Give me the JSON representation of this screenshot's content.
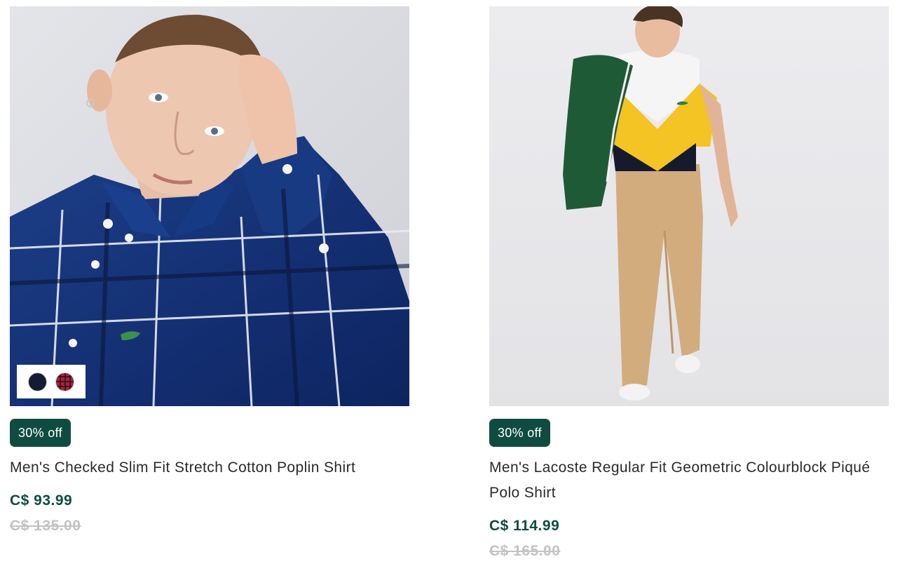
{
  "products": [
    {
      "image_alt": "Model wearing a blue checked button-down shirt",
      "swatches": [
        {
          "name": "Navy",
          "color": "#141c33"
        },
        {
          "name": "Red check",
          "color": "#b3202c"
        }
      ],
      "discount_badge": "30% off",
      "title": "Men's Checked Slim Fit Stretch Cotton Poplin Shirt",
      "price": "C$ 93.99",
      "original_price": "C$ 135.00"
    },
    {
      "image_alt": "Model wearing a yellow, white and black colourblock polo with beige trousers",
      "discount_badge": "30% off",
      "title": "Men's Lacoste Regular Fit Geometric Colourblock Piqué Polo Shirt",
      "price": "C$ 114.99",
      "original_price": "C$ 165.00"
    }
  ],
  "colors": {
    "brand_green": "#0f4c3f",
    "strike_grey": "#c3c3c3"
  }
}
